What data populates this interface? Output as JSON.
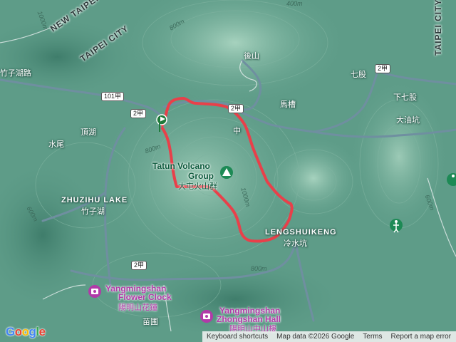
{
  "map": {
    "route_color": "#e8404a",
    "city_labels": [
      "NEW TAIPEI CITY",
      "TAIPEI CITY",
      "TAIPEI CITY"
    ],
    "places": {
      "top_left_road": "竹子湖路",
      "houshan": "後山",
      "qigu": "七股",
      "xiaqigu": "下七股",
      "dayoukeng": "大油坑",
      "mazao": "馬槽",
      "dinghu": "頂湖",
      "shuiwei": "水尾",
      "zhongX": "中",
      "zhuzihu_en": "ZHUZIHU LAKE",
      "zhuzihu_zh": "竹子湖",
      "lengshuikeng_en": "LENGSHUIKENG",
      "lengshuikeng_zh": "冷水坑",
      "miaopu": "苗圃"
    },
    "volcano": {
      "name_en_line1": "Tatun Volcano",
      "name_en_line2": "Group",
      "name_zh": "大屯火山群"
    },
    "poi": {
      "flower_clock_en_line1": "Yangmingshan",
      "flower_clock_en_line2": "Flower Clock",
      "flower_clock_zh": "陽明山花鐘",
      "zhongshan_hall_en_line1": "Yangmingshan",
      "zhongshan_hall_en_line2": "Zhongshan Hall",
      "zhongshan_hall_zh": "陽明山中山樓"
    },
    "road_shields": [
      "101甲",
      "2甲",
      "2甲",
      "2甲",
      "2甲"
    ],
    "elevation_labels": [
      "1000m",
      "400m",
      "800m",
      "800m",
      "1000m",
      "600m",
      "800m",
      "600m"
    ]
  },
  "attribution": {
    "shortcuts": "Keyboard shortcuts",
    "map_data": "Map data ©2026 Google",
    "terms": "Terms",
    "report": "Report a map error"
  },
  "logo": "Google"
}
